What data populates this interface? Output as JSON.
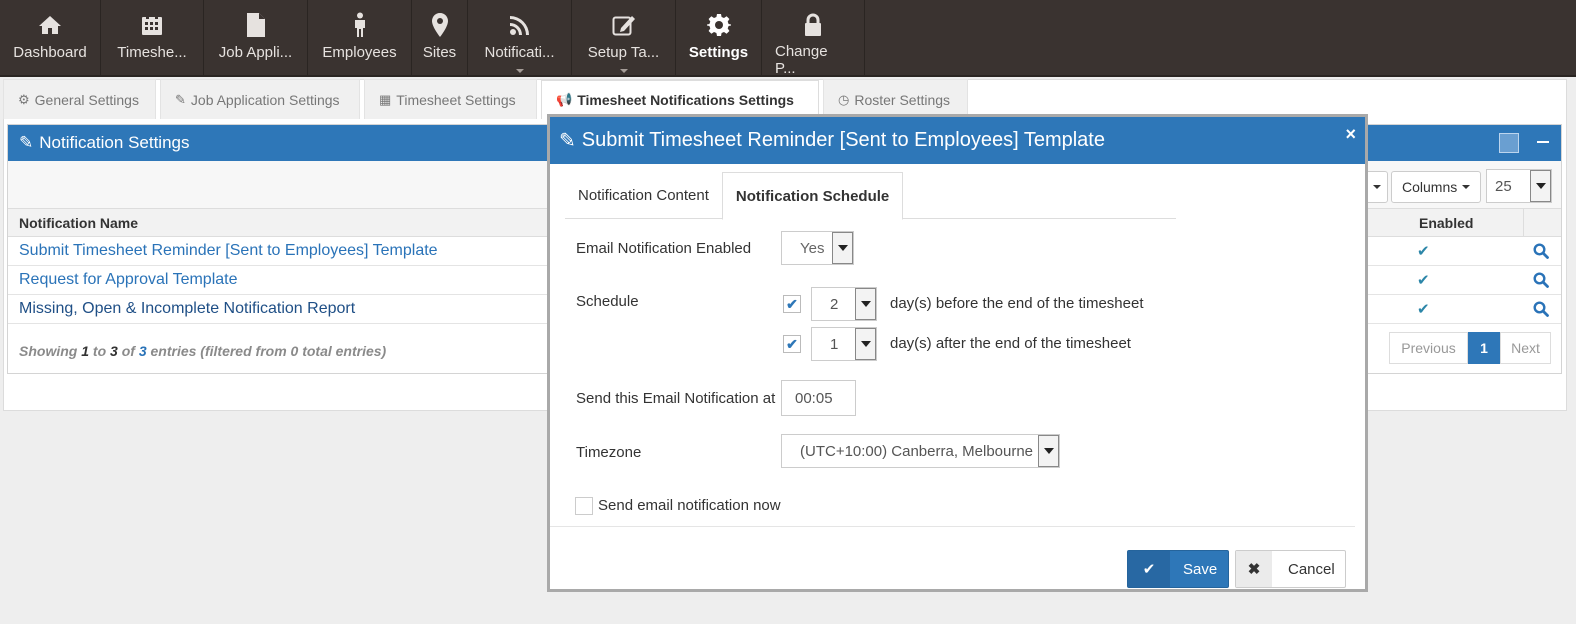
{
  "nav": {
    "items": [
      {
        "label": "Dashboard",
        "icon": "home-icon"
      },
      {
        "label": "Timeshe...",
        "icon": "calendar-icon"
      },
      {
        "label": "Job Appli...",
        "icon": "file-icon"
      },
      {
        "label": "Employees",
        "icon": "person-icon"
      },
      {
        "label": "Sites",
        "icon": "map-marker-icon"
      },
      {
        "label": "Notificati...",
        "icon": "rss-icon"
      },
      {
        "label": "Setup Ta...",
        "icon": "edit-icon"
      },
      {
        "label": "Settings",
        "icon": "gear-icon"
      },
      {
        "label": "Change P...",
        "icon": "lock-icon"
      }
    ]
  },
  "subtabs": [
    {
      "label": "General Settings"
    },
    {
      "label": "Job Application Settings"
    },
    {
      "label": "Timesheet Settings"
    },
    {
      "label": "Timesheet Notifications Settings"
    },
    {
      "label": "Roster Settings"
    }
  ],
  "widget": {
    "title": "Notification Settings",
    "columns_label": "Columns",
    "page_size": "25",
    "col_name": "Notification Name",
    "col_enabled": "Enabled",
    "rows": [
      {
        "name": "Submit Timesheet Reminder [Sent to Employees] Template",
        "enabled": "✔"
      },
      {
        "name": "Request for Approval Template",
        "enabled": "✔"
      },
      {
        "name": "Missing, Open & Incomplete Notification Report",
        "enabled": "✔"
      }
    ],
    "info": {
      "prefix": "Showing ",
      "from": "1",
      "to_word": " to ",
      "to": "3",
      "of_word": " of ",
      "total": "3",
      "suffix": " entries (filtered from 0 total entries)"
    },
    "pager": {
      "previous": "Previous",
      "current": "1",
      "next": "Next"
    }
  },
  "modal": {
    "title": "Submit Timesheet Reminder [Sent to Employees] Template",
    "close": "×",
    "tabs": [
      {
        "label": "Notification Content"
      },
      {
        "label": "Notification Schedule"
      }
    ],
    "email_enabled_label": "Email Notification Enabled",
    "email_enabled_value": "Yes",
    "schedule_label": "Schedule",
    "schedule_before_value": "2",
    "schedule_before_text": "day(s) before the end of the timesheet",
    "schedule_after_value": "1",
    "schedule_after_text": "day(s) after the end of the timesheet",
    "send_at_label": "Send this Email Notification at",
    "send_at_value": "00:05",
    "timezone_label": "Timezone",
    "timezone_value": "(UTC+10:00) Canberra, Melbourne",
    "send_now_label": "Send email notification now",
    "save_label": "Save",
    "cancel_label": "Cancel"
  }
}
